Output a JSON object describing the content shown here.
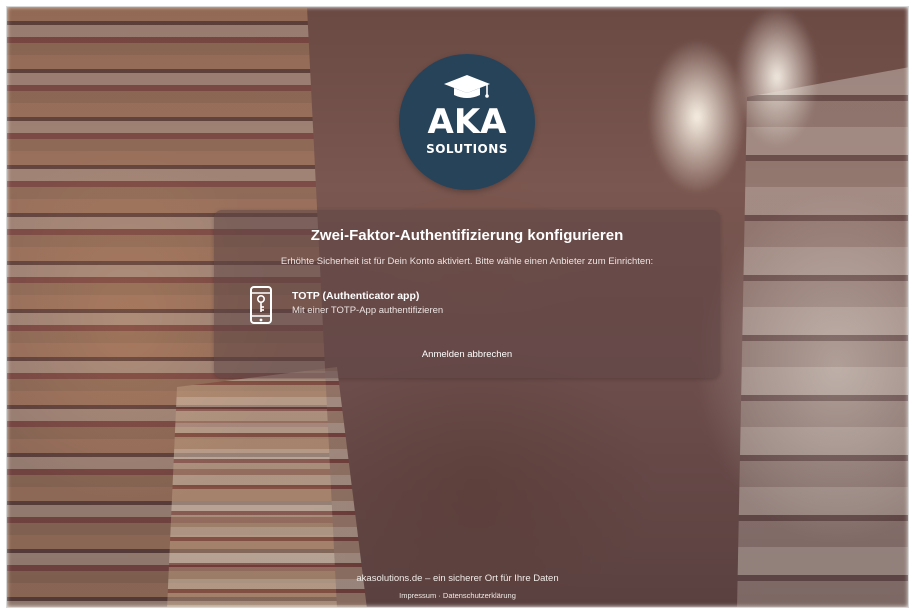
{
  "brand": {
    "name": "AKA",
    "subname": "SOLUTIONS",
    "logo_color": "#27435a"
  },
  "card": {
    "title": "Zwei-Faktor-Authentifizierung konfigurieren",
    "description": "Erhöhte Sicherheit ist für Dein Konto aktiviert. Bitte wähle einen Anbieter zum Einrichten:",
    "providers": [
      {
        "name": "TOTP (Authenticator app)",
        "description": "Mit einer TOTP-App authentifizieren",
        "icon": "phone-key-icon"
      }
    ],
    "cancel_label": "Anmelden abbrechen"
  },
  "footer": {
    "tagline": "akasolutions.de – ein sicherer Ort für Ihre Daten",
    "imprint_label": "Impressum",
    "separator": "·",
    "privacy_label": "Datenschutzerklärung"
  },
  "icons": {
    "logo": "graduation-cap-icon",
    "provider": "phone-key-icon"
  }
}
